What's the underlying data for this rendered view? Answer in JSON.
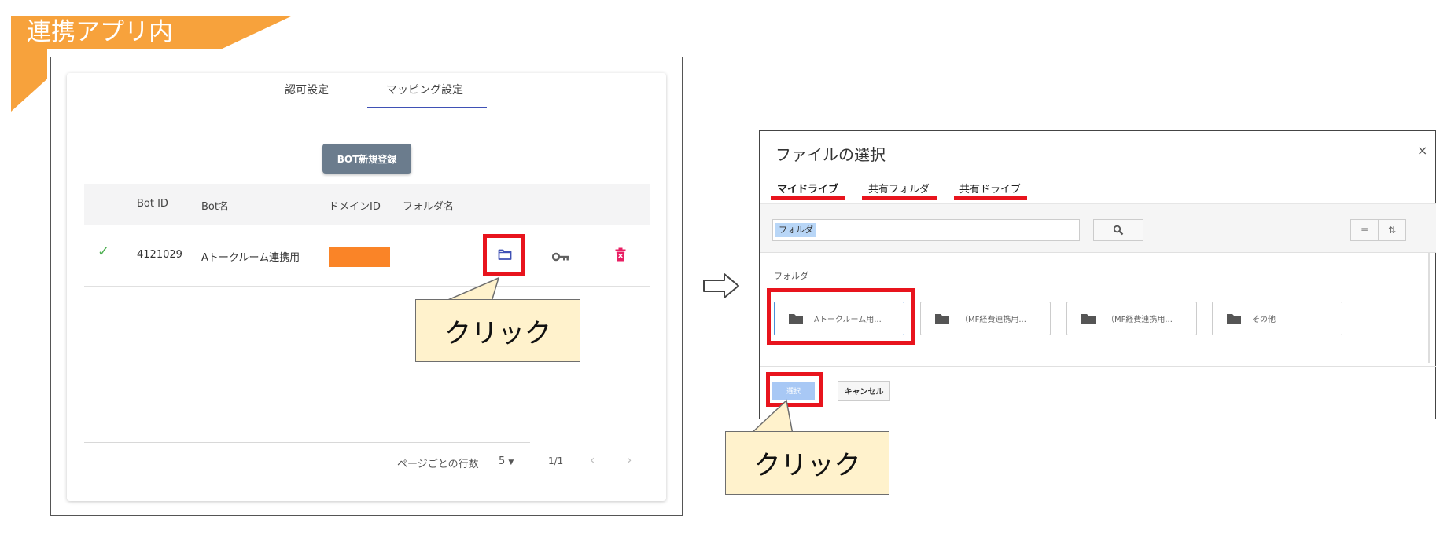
{
  "banner": {
    "text": "連携アプリ内"
  },
  "left": {
    "tabs": [
      {
        "label": "認可設定",
        "active": false
      },
      {
        "label": "マッピング設定",
        "active": true
      }
    ],
    "new_bot_button": "BOT新規登録",
    "columns": [
      "Bot ID",
      "Bot名",
      "ドメインID",
      "フォルダ名"
    ],
    "row": {
      "status_icon": "check-icon",
      "bot_id": "4121029",
      "bot_name": "Aトークルーム連携用",
      "domain_id_color": "#fa8427",
      "folder_name": ""
    },
    "action_icons": [
      "folder-icon",
      "key-icon",
      "trash-icon"
    ],
    "callout": "クリック",
    "pagination": {
      "rows_per_page_label": "ページごとの行数",
      "rows_per_page_value": "5",
      "page_info": "1/1"
    }
  },
  "right": {
    "title": "ファイルの選択",
    "close": "×",
    "tabs": [
      "マイドライブ",
      "共有フォルダ",
      "共有ドライブ"
    ],
    "search_value": "フォルダ",
    "section_label": "フォルダ",
    "folders": [
      {
        "label": "Aトークルーム用...",
        "selected": true
      },
      {
        "label": "（MF経費連携用...",
        "selected": false
      },
      {
        "label": "（MF経費連携用...",
        "selected": false
      },
      {
        "label": "その他",
        "selected": false
      }
    ],
    "select_button": "選択",
    "cancel_button": "キャンセル",
    "callout": "クリック"
  },
  "colors": {
    "banner": "#f7a23c",
    "highlight": "#e8141d",
    "callout_fill": "#fff2cc",
    "accent": "#3f51b5",
    "delete": "#e91e63"
  }
}
